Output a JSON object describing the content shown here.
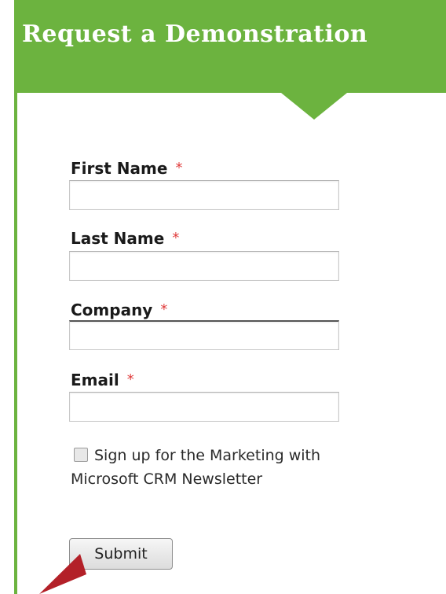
{
  "header": {
    "title": "Request a Demonstration"
  },
  "form": {
    "fields": [
      {
        "label": "First Name",
        "required_mark": "*",
        "value": ""
      },
      {
        "label": "Last Name",
        "required_mark": "*",
        "value": ""
      },
      {
        "label": "Company",
        "required_mark": "*",
        "value": ""
      },
      {
        "label": "Email",
        "required_mark": "*",
        "value": ""
      }
    ],
    "newsletter": {
      "label": "Sign up for the Marketing with Microsoft CRM Newsletter",
      "checked": false
    },
    "submit_label": "Submit"
  },
  "colors": {
    "brand_green": "#6cb33f",
    "required_red": "#e03c3c",
    "arrow_red": "#b32028"
  },
  "icons": {
    "annotation_arrow": "red-arrow-icon"
  }
}
